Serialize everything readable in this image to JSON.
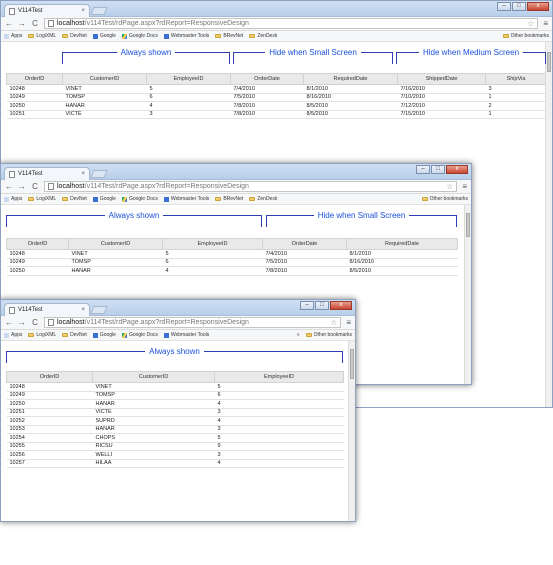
{
  "browser": {
    "tab_title": "V114Test",
    "tab_close": "×",
    "url_host": "localhost",
    "url_path": "/v114Test/rdPage.aspx?rdReport=ResponsiveDesign",
    "back_glyph": "←",
    "forward_glyph": "→",
    "reload_glyph": "C",
    "star_glyph": "☆",
    "menu_glyph": "≡",
    "min_glyph": "–",
    "max_glyph": "□",
    "close_glyph": "x",
    "bookmarks": [
      "Apps",
      "LogiXML",
      "DevNet",
      "Google",
      "Google Docs",
      "Webmaster Tools",
      "BRevNet",
      "ZenDesk"
    ],
    "other_bookmarks": "Other bookmarks",
    "overflow_glyph": "»"
  },
  "groups": {
    "always": "Always shown",
    "small": "Hide when Small Screen",
    "medium": "Hide when Medium Screen"
  },
  "columns": {
    "order_id": "OrderID",
    "customer_id": "CustomerID",
    "employee_id": "EmployeeID",
    "order_date": "OrderDate",
    "required_date": "RequiredDate",
    "shipped_date": "ShippedDate",
    "ship_via": "ShipVia"
  },
  "rows_large": [
    [
      "10248",
      "VINET",
      "5",
      "7/4/2010",
      "8/1/2010",
      "7/16/2010",
      "3"
    ],
    [
      "10249",
      "TOMSP",
      "6",
      "7/5/2010",
      "8/16/2010",
      "7/10/2010",
      "1"
    ],
    [
      "10250",
      "HANAR",
      "4",
      "7/8/2010",
      "8/5/2010",
      "7/12/2010",
      "2"
    ],
    [
      "10251",
      "VICTE",
      "3",
      "7/8/2010",
      "8/5/2010",
      "7/15/2010",
      "1"
    ]
  ],
  "rows_medium": [
    [
      "10248",
      "VINET",
      "5",
      "7/4/2010",
      "8/1/2010"
    ],
    [
      "10249",
      "TOMSP",
      "6",
      "7/5/2010",
      "8/16/2010"
    ],
    [
      "10250",
      "HANAR",
      "4",
      "7/8/2010",
      "8/5/2010"
    ]
  ],
  "rows_small": [
    [
      "10248",
      "VINET",
      "5"
    ],
    [
      "10249",
      "TOMSP",
      "6"
    ],
    [
      "10250",
      "HANAR",
      "4"
    ],
    [
      "10251",
      "VICTE",
      "3"
    ],
    [
      "10252",
      "SUPRD",
      "4"
    ],
    [
      "10253",
      "HANAR",
      "3"
    ],
    [
      "10254",
      "CHOPS",
      "5"
    ],
    [
      "10255",
      "RICSU",
      "9"
    ],
    [
      "10256",
      "WELLI",
      "3"
    ],
    [
      "10257",
      "HILAA",
      "4"
    ]
  ],
  "colors": {
    "group_border": "#2d3fb3",
    "group_label": "#1a4fd8",
    "header_bg": "#e9e9e9"
  }
}
